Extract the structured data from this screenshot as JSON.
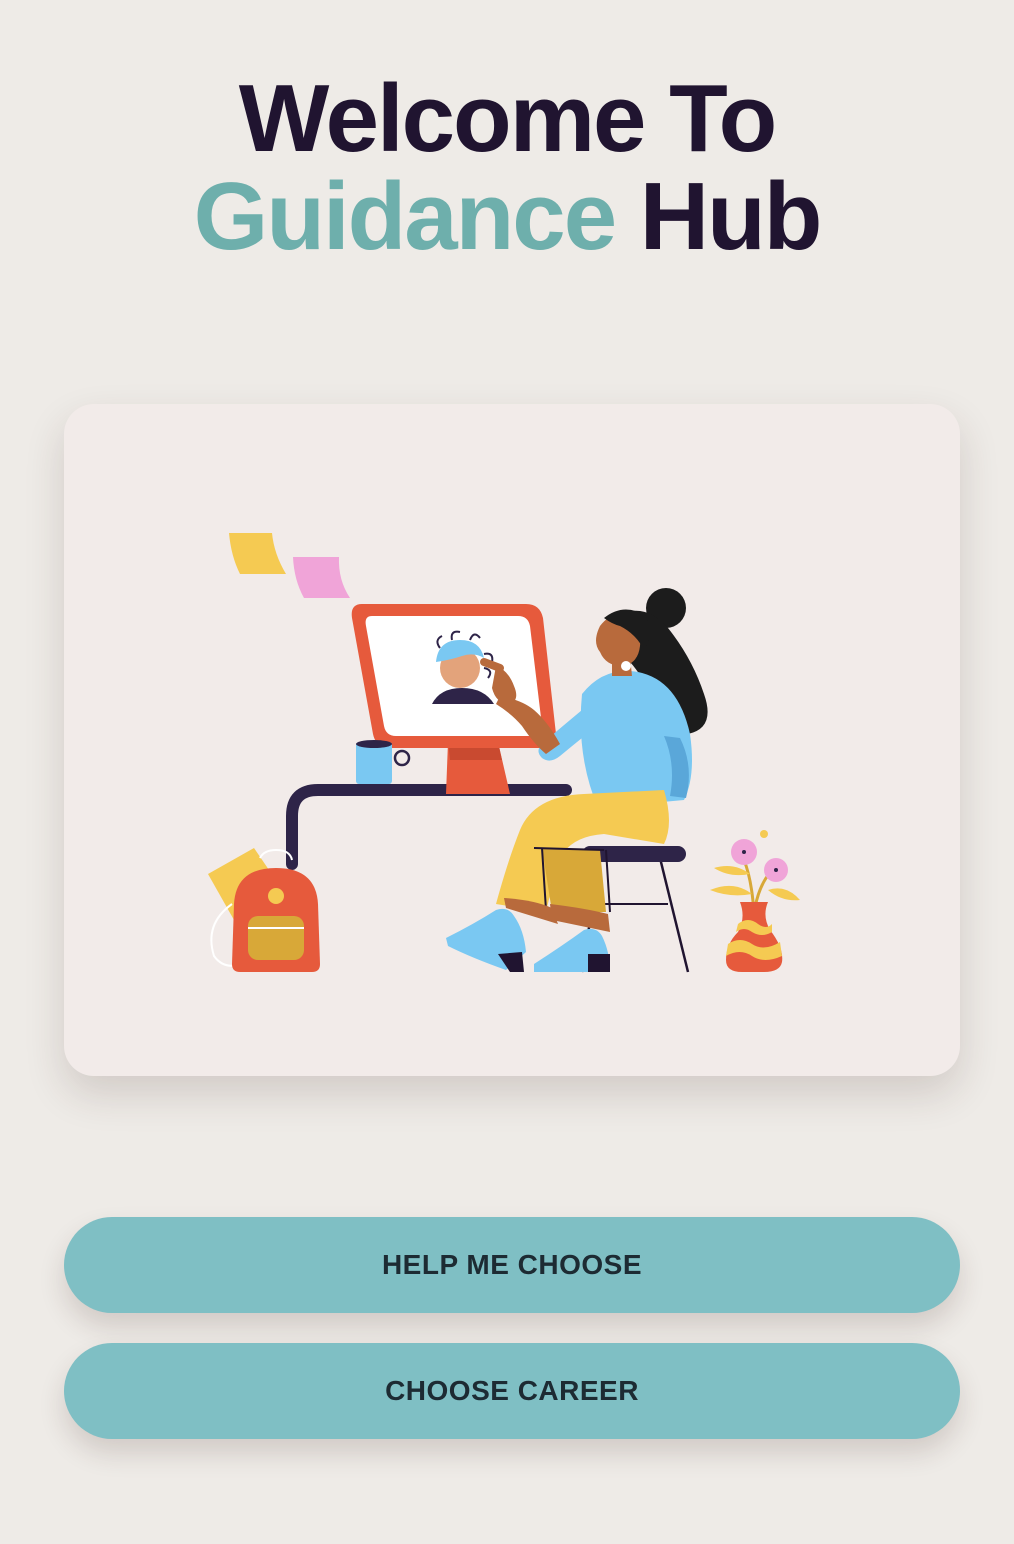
{
  "header": {
    "welcome_text": "Welcome To",
    "brand_first": "Guidance",
    "brand_second": "Hub",
    "accent_color": "#6eafac",
    "title_color": "#201430"
  },
  "hero": {
    "illustration": "woman-at-computer-illustration"
  },
  "actions": {
    "help_me_choose_label": "HELP ME CHOOSE",
    "choose_career_label": "CHOOSE CAREER",
    "button_color": "#7fbfc4"
  }
}
